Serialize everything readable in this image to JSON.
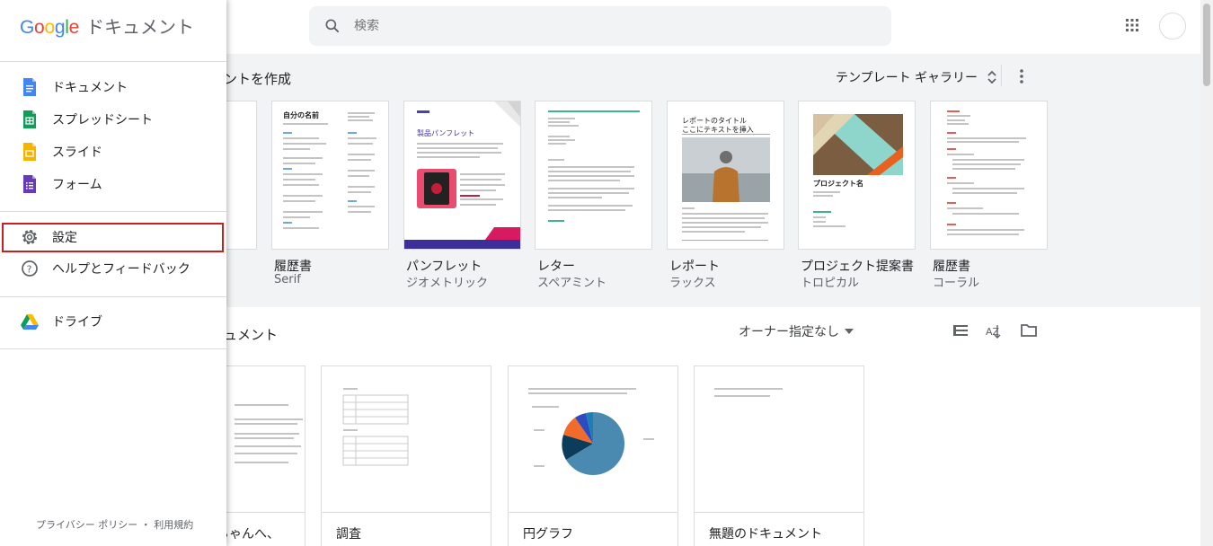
{
  "sidebar": {
    "logo_google": "Google",
    "logo_product": "ドキュメント",
    "items": [
      {
        "label": "ドキュメント",
        "icon": "docs-icon",
        "color": "#4285f4"
      },
      {
        "label": "スプレッドシート",
        "icon": "sheets-icon",
        "color": "#0f9d58"
      },
      {
        "label": "スライド",
        "icon": "slides-icon",
        "color": "#f4b400"
      },
      {
        "label": "フォーム",
        "icon": "forms-icon",
        "color": "#673ab7"
      }
    ],
    "settings_label": "設定",
    "help_label": "ヘルプとフィードバック",
    "drive_label": "ドライブ",
    "footer": "プライバシー ポリシー ・ 利用規約"
  },
  "search": {
    "placeholder": "検索"
  },
  "templates": {
    "section_title": "メントを作成",
    "gallery_label": "テンプレート ギャラリー",
    "cards": [
      {
        "name": "履歴書",
        "sub": "Serif"
      },
      {
        "name": "パンフレット",
        "sub": "ジオメトリック"
      },
      {
        "name": "レター",
        "sub": "スペアミント"
      },
      {
        "name": "レポート",
        "sub": "ラックス"
      },
      {
        "name": "プロジェクト提案書",
        "sub": "トロピカル"
      },
      {
        "name": "履歴書",
        "sub": "コーラル"
      }
    ],
    "thumb_texts": {
      "resume_title": "自分の名前",
      "brochure_title": "製品パンフレット",
      "report_title": "レポートのタイトル",
      "report_sub": "ここにテキストを挿入",
      "proposal_title": "プロジェクト名"
    }
  },
  "recent": {
    "section_title": "キュメント",
    "owner_filter": "オーナー指定なし",
    "docs": [
      {
        "name": "ちゃんへ、"
      },
      {
        "name": "調査"
      },
      {
        "name": "円グラフ"
      },
      {
        "name": "無題のドキュメント"
      }
    ]
  },
  "colors": {
    "accent": "#4285f4",
    "highlight_border": "#c5221f",
    "section_bg": "#f1f3f4"
  }
}
